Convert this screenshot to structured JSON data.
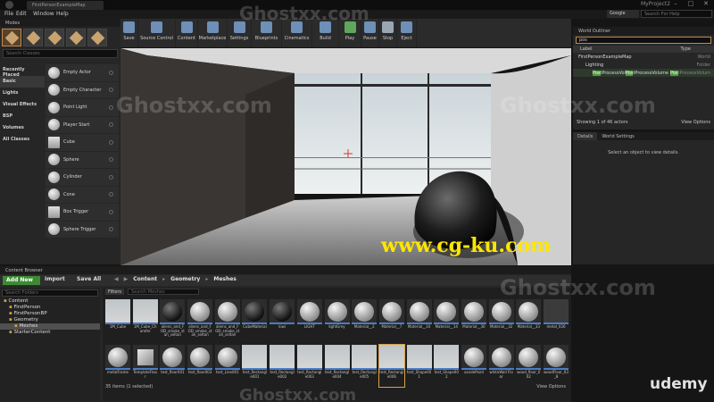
{
  "window": {
    "map_tab": "FirstPersonExampleMap",
    "project_name": "MyProject2",
    "controls": [
      "–",
      "□",
      "✕"
    ]
  },
  "menu": [
    "File",
    "Edit",
    "Window",
    "Help"
  ],
  "header_search": {
    "provider": "Google",
    "placeholder": "Search For Help"
  },
  "modes": {
    "tab": "Modes",
    "search_placeholder": "Search Classes",
    "categories": [
      "Recently Placed",
      "Basic",
      "Lights",
      "Visual Effects",
      "BSP",
      "Volumes",
      "All Classes"
    ],
    "active_category": "Basic",
    "items": [
      {
        "label": "Empty Actor",
        "icon": "sphere-icon"
      },
      {
        "label": "Empty Character",
        "icon": "sphere-icon"
      },
      {
        "label": "Point Light",
        "icon": "light-bulb-icon"
      },
      {
        "label": "Player Start",
        "icon": "player-start-icon"
      },
      {
        "label": "Cube",
        "icon": "cube-icon"
      },
      {
        "label": "Sphere",
        "icon": "sphere-icon"
      },
      {
        "label": "Cylinder",
        "icon": "cylinder-icon"
      },
      {
        "label": "Cone",
        "icon": "cone-icon"
      },
      {
        "label": "Box Trigger",
        "icon": "box-trigger-icon"
      },
      {
        "label": "Sphere Trigger",
        "icon": "sphere-trigger-icon"
      }
    ]
  },
  "toolbar": [
    {
      "label": "Save",
      "icon": "save-icon",
      "w": 20
    },
    {
      "label": "Source Control",
      "icon": "source-control-icon",
      "w": 42
    },
    {
      "label": "Content",
      "icon": "content-icon",
      "w": 25
    },
    {
      "label": "Marketplace",
      "icon": "marketplace-icon",
      "w": 33
    },
    {
      "label": "Settings",
      "icon": "settings-icon",
      "w": 27
    },
    {
      "label": "Blueprints",
      "icon": "blueprints-icon",
      "w": 34
    },
    {
      "label": "Cinematics",
      "icon": "cinematics-icon",
      "w": 34
    },
    {
      "label": "Build",
      "icon": "build-icon",
      "w": 30
    },
    {
      "label": "Play",
      "icon": "play-icon",
      "w": 25
    },
    {
      "label": "Pause",
      "icon": "pause-icon",
      "w": 20
    },
    {
      "label": "Stop",
      "icon": "stop-icon",
      "w": 20
    },
    {
      "label": "Eject",
      "icon": "eject-icon",
      "w": 22
    }
  ],
  "outliner": {
    "tab": "World Outliner",
    "search_value": "pos",
    "columns": [
      "Label",
      "Type"
    ],
    "rows": [
      {
        "label": "FirstPersonExampleMap",
        "type": "World",
        "indent": 0
      },
      {
        "label": "Lighting",
        "type": "Folder",
        "indent": 1
      },
      {
        "label_parts": [
          "",
          "Pos",
          "tProcessVol",
          "Pos",
          "tProcessVolume"
        ],
        "type_parts": [
          "Pos",
          "tProcessVolum"
        ],
        "indent": 2
      }
    ],
    "footer_left": "Showing 1 of 46 actors",
    "footer_right": "View Options"
  },
  "details": {
    "tabs": [
      "Details",
      "World Settings"
    ],
    "empty_message": "Select an object to view details."
  },
  "content_browser": {
    "tab": "Content Browser",
    "add_new": "Add New",
    "import": "Import",
    "save_all": "Save All",
    "path": [
      "Content",
      "Geometry",
      "Meshes"
    ],
    "tree_search_placeholder": "Search Folders",
    "tree": [
      {
        "label": "Content",
        "indent": 0
      },
      {
        "label": "FirstPerson",
        "indent": 1
      },
      {
        "label": "FirstPersonBP",
        "indent": 1
      },
      {
        "label": "Geometry",
        "indent": 1
      },
      {
        "label": "Meshes",
        "indent": 2,
        "selected": true
      },
      {
        "label": "StarterContent",
        "indent": 1
      }
    ],
    "filters_label": "Filters",
    "asset_search_placeholder": "Search Meshes",
    "assets": [
      {
        "name": "1M_Cube",
        "thumb": "flat"
      },
      {
        "name": "1M_Cube_Chamfer",
        "thumb": "flat"
      },
      {
        "name": "aliens_and_FOD_smoke_stan_seltan",
        "thumb": "dark"
      },
      {
        "name": "aliens_and_FOD_smoke_stan_seltan",
        "thumb": "ball"
      },
      {
        "name": "aliens_and_FOD_smoke_stan_seltan",
        "thumb": "ball"
      },
      {
        "name": "CubeMaterial",
        "thumb": "dark"
      },
      {
        "name": "kiwi",
        "thumb": "dark"
      },
      {
        "name": "LIGHT",
        "thumb": "ball"
      },
      {
        "name": "lightGrey",
        "thumb": "ball"
      },
      {
        "name": "Material__2",
        "thumb": "ball"
      },
      {
        "name": "Material__7",
        "thumb": "ball"
      },
      {
        "name": "Material__10",
        "thumb": "ball"
      },
      {
        "name": "Material__14",
        "thumb": "ball"
      },
      {
        "name": "Material__30",
        "thumb": "ball"
      },
      {
        "name": "Material__32",
        "thumb": "ball"
      },
      {
        "name": "Material__33",
        "thumb": "ball"
      },
      {
        "name": "metal_026",
        "thumb": "blank"
      },
      {
        "name": "metalFrame",
        "thumb": "ball"
      },
      {
        "name": "TemplateFloor",
        "thumb": "cube"
      },
      {
        "name": "test_floor001",
        "thumb": "ball"
      },
      {
        "name": "test_floor003",
        "thumb": "ball"
      },
      {
        "name": "test_Line001",
        "thumb": "ball"
      },
      {
        "name": "test_Rectangle001",
        "thumb": "flat"
      },
      {
        "name": "test_Rectangle002",
        "thumb": "flat"
      },
      {
        "name": "test_Rectangle003",
        "thumb": "flat"
      },
      {
        "name": "test_Rectangle004",
        "thumb": "flat"
      },
      {
        "name": "test_Rectangle005",
        "thumb": "flat"
      },
      {
        "name": "test_Rectangle006",
        "thumb": "flat"
      },
      {
        "name": "test_Shape001",
        "thumb": "flat"
      },
      {
        "name": "test_Shape002",
        "thumb": "flat"
      },
      {
        "name": "vandePaint",
        "thumb": "ball"
      },
      {
        "name": "whiteWall Floor",
        "thumb": "ball"
      },
      {
        "name": "wood_floor_002",
        "thumb": "ball"
      },
      {
        "name": "woodFloor_03_8",
        "thumb": "ball"
      }
    ],
    "selected_asset_index": 27,
    "footer_left": "35 items (1 selected)",
    "footer_right": "View Options"
  },
  "watermarks": {
    "cg": "www.cg-ku.com",
    "ghost": "Ghostxx.com",
    "brand": "udemy"
  }
}
